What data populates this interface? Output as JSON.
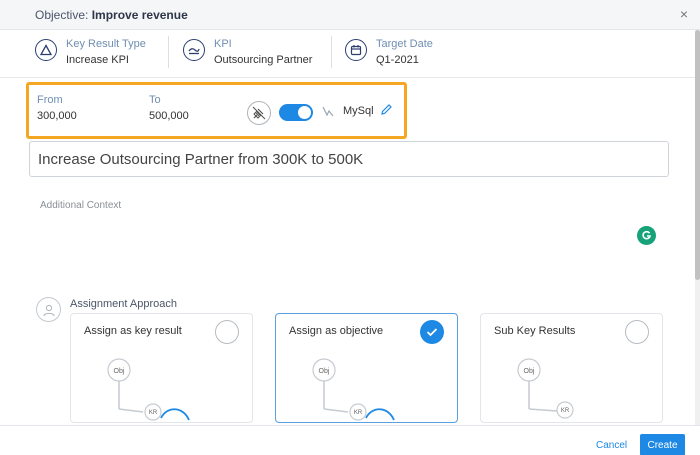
{
  "header": {
    "objective_prefix": "Objective:",
    "objective_name": "Improve revenue",
    "close_icon": "×"
  },
  "meta": {
    "key_result_type": {
      "label": "Key Result Type",
      "value": "Increase KPI"
    },
    "kpi": {
      "label": "KPI",
      "value": "Outsourcing Partner"
    },
    "target_date": {
      "label": "Target Date",
      "value": "Q1-2021"
    }
  },
  "range": {
    "from_label": "From",
    "from_value": "300,000",
    "to_label": "To",
    "to_value": "500,000",
    "toggle_on": true,
    "datasource": "MySql"
  },
  "key_result_title": "Increase Outsourcing Partner from 300K to 500K",
  "context_placeholder": "Additional Context",
  "assignment": {
    "label": "Assignment Approach",
    "options": [
      {
        "label": "Assign as key result",
        "selected": false,
        "node_top": "Obj",
        "node_child": "KR"
      },
      {
        "label": "Assign as objective",
        "selected": true,
        "node_top": "Obj",
        "node_child": "KR"
      },
      {
        "label": "Sub Key Results",
        "selected": false,
        "node_top": "Obj",
        "node_child": "KR"
      }
    ]
  },
  "footer": {
    "cancel_label": "Cancel",
    "create_label": "Create"
  },
  "colors": {
    "accent": "#1e88e5",
    "highlight_border": "#f5a623",
    "grammarly": "#16a37a"
  }
}
